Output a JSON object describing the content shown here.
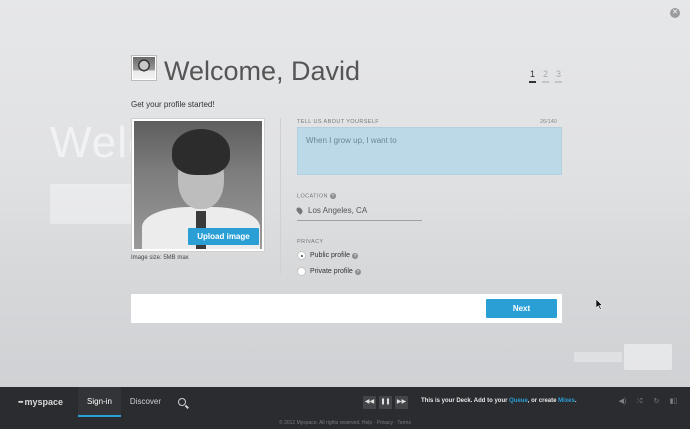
{
  "header": {
    "welcome": "Welcome, David",
    "steps": [
      "1",
      "2",
      "3"
    ],
    "active_step": 1
  },
  "subhead": "Get your profile started!",
  "photo": {
    "upload_label": "Upload image",
    "size_note": "Image size: 5MB max"
  },
  "about": {
    "label": "TELL US ABOUT YOURSELF",
    "count": "26/140",
    "placeholder": "When I grow up, I want to"
  },
  "location": {
    "label": "LOCATION",
    "value": "Los Angeles, CA"
  },
  "privacy": {
    "label": "PRIVACY",
    "options": [
      {
        "label": "Public profile",
        "selected": true
      },
      {
        "label": "Private profile",
        "selected": false
      }
    ]
  },
  "next_label": "Next",
  "background": {
    "ghost_title": "Welco"
  },
  "bottombar": {
    "logo": "myspace",
    "nav": [
      "Sign-in",
      "Discover"
    ],
    "deck_prefix": "This is your Deck. Add to your ",
    "deck_link1": "Queue",
    "deck_mid": ", or create ",
    "deck_link2": "Mixes",
    "deck_suffix": "."
  },
  "footer": "© 2012 Myspace. All rights reserved. Help · Privacy · Terms",
  "colors": {
    "accent": "#2a9fd6",
    "bar": "#2b2c2f",
    "about_box": "#bcd9e8"
  }
}
